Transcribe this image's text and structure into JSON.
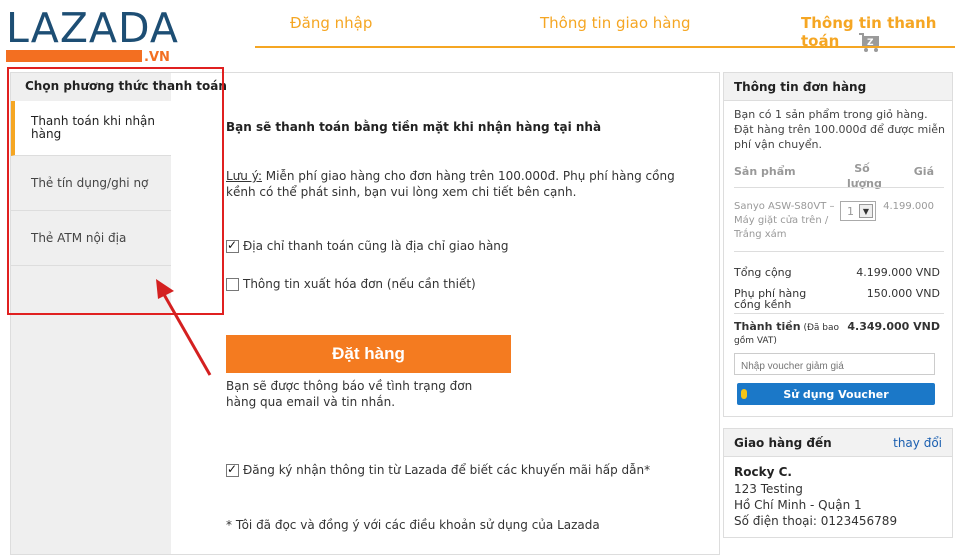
{
  "logo": {
    "brand": "LAZADA",
    "suffix": ".VN"
  },
  "steps": {
    "login": "Đăng nhập",
    "shipping": "Thông tin giao hàng",
    "payment": "Thông tin thanh toán"
  },
  "sidebar": {
    "title": "Chọn phương thức thanh toán",
    "methods": [
      "Thanh toán khi nhận hàng",
      "Thẻ tín dụng/ghi nợ",
      "Thẻ ATM nội địa"
    ],
    "selected_index": 0
  },
  "main": {
    "heading": "Bạn sẽ thanh toán bằng tiền mặt khi nhận hàng tại nhà",
    "note_label": "Lưu ý:",
    "note_text": " Miễn phí giao hàng cho đơn hàng trên 100.000đ. Phụ phí hàng cồng kềnh có thể phát sinh, bạn vui lòng xem chi tiết bên cạnh.",
    "billing_same_label": "Địa chỉ thanh toán cũng là địa chỉ giao hàng",
    "billing_same_checked": true,
    "invoice_label": "Thông tin xuất hóa đơn (nếu cần thiết)",
    "invoice_checked": false,
    "order_button": "Đặt hàng",
    "notify_text": "Bạn sẽ được thông báo về tình trạng đơn hàng qua email và tin nhắn.",
    "subscribe_label": "Đăng ký nhận thông tin từ Lazada để biết các khuyến mãi hấp dẫn*",
    "subscribe_checked": true,
    "terms_text": "* Tôi đã đọc và đồng ý với các điều khoản sử dụng của Lazada"
  },
  "order": {
    "title": "Thông tin đơn hàng",
    "description": "Bạn có 1 sản phẩm trong giỏ hàng. Đặt hàng trên 100.000đ để được miễn phí vận chuyển.",
    "col_product": "Sản phẩm",
    "col_qty": "Số lượng",
    "col_price": "Giá",
    "product_name": "Sanyo ASW-S80VT – Máy giặt cửa trên / Trắng xám",
    "product_qty": "1",
    "product_price": "4.199.000",
    "total_label": "Tổng cộng",
    "total_value": "4.199.000 VND",
    "surcharge_label": "Phụ phí hàng cồng kềnh",
    "surcharge_value": "150.000 VND",
    "grand_label": "Thành tiền",
    "grand_note": " (Đã bao gồm VAT)",
    "grand_value": "4.349.000 VND",
    "voucher_placeholder": "Nhập voucher giảm giá",
    "voucher_button": "Sử dụng Voucher"
  },
  "shipping": {
    "title": "Giao hàng đến",
    "change_link": "thay đổi",
    "name": "Rocky C.",
    "street": "123 Testing",
    "city": "Hồ Chí Minh - Quận 1",
    "phone": "Số điện thoại: 0123456789"
  },
  "colors": {
    "accent": "#f5a623",
    "button": "#f47b20",
    "brand_blue": "#1d4e74",
    "highlight": "#e02020",
    "voucher_blue": "#1b78c8"
  }
}
